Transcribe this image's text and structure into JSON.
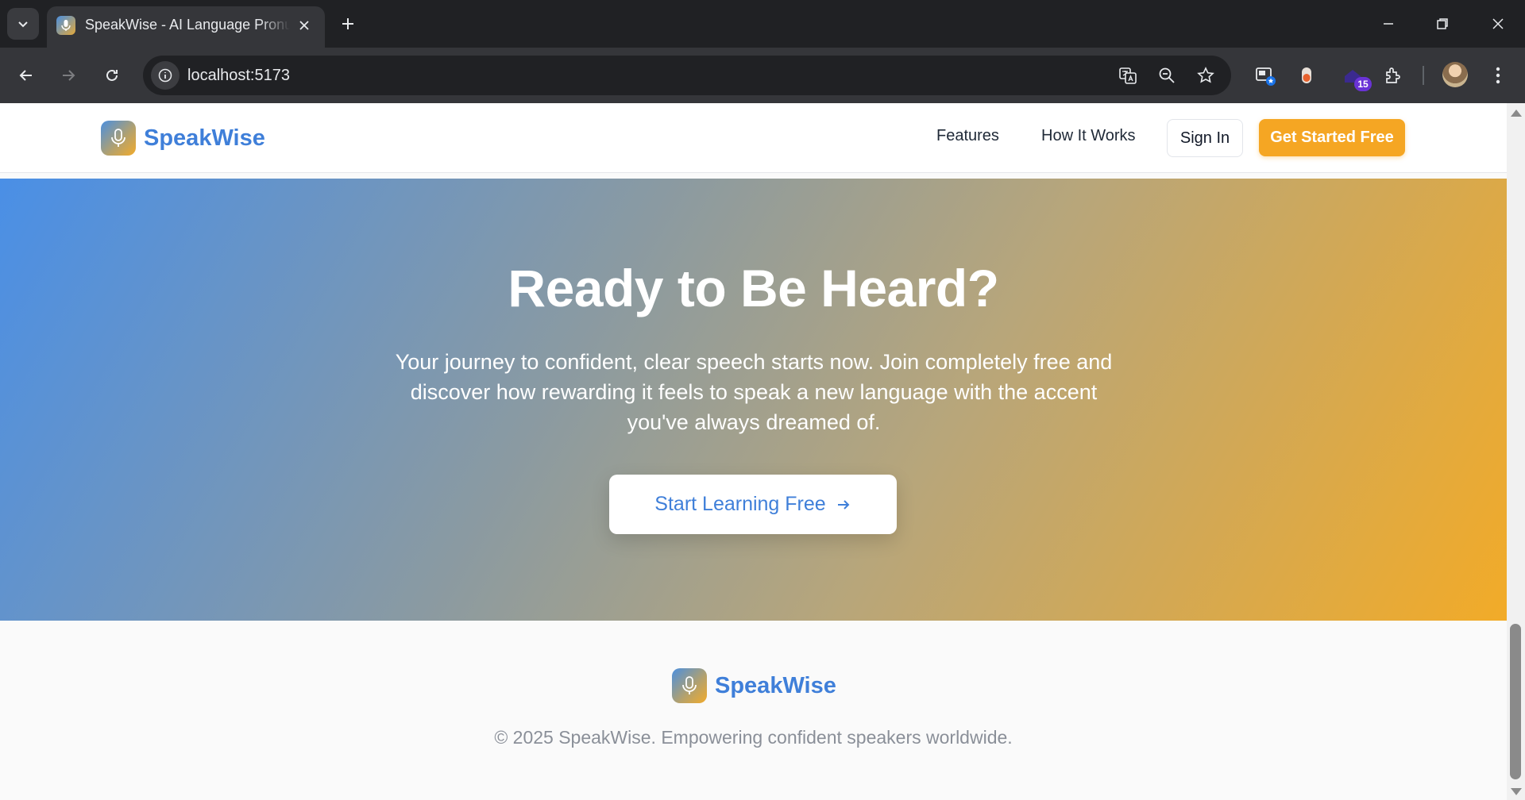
{
  "browser": {
    "tab_title": "SpeakWise - AI Language Pronunciation",
    "url": "localhost:5173",
    "extension_badge": "15"
  },
  "site": {
    "brand_name": "SpeakWise",
    "nav": {
      "features": "Features",
      "how_it_works": "How It Works",
      "sign_in": "Sign In",
      "get_started": "Get Started Free"
    },
    "hero": {
      "title": "Ready to Be Heard?",
      "subtitle": "Your journey to confident, clear speech starts now. Join completely free and discover how rewarding it feels to speak a new language with the accent you've always dreamed of.",
      "cta": "Start Learning Free"
    },
    "footer": {
      "brand_name": "SpeakWise",
      "copyright": "© 2025 SpeakWise. Empowering confident speakers worldwide."
    }
  },
  "colors": {
    "brand_blue": "#3f7fd9",
    "accent_orange": "#f5a623"
  },
  "icons": [
    "tab-search-icon",
    "microphone-icon",
    "close-icon",
    "plus-icon",
    "minimize-icon",
    "restore-icon",
    "back-icon",
    "forward-icon",
    "reload-icon",
    "site-info-icon",
    "translate-icon",
    "zoom-out-icon",
    "star-icon",
    "extensions-icon",
    "more-icon",
    "arrow-right-icon"
  ]
}
